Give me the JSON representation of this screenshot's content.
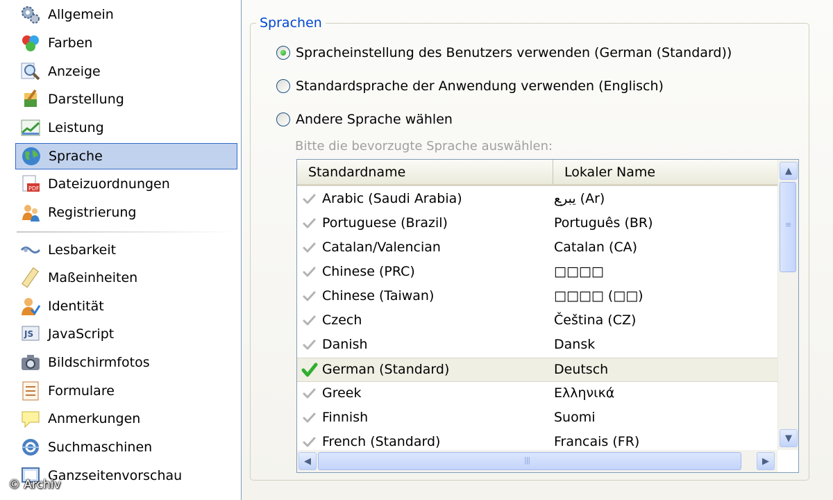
{
  "sidebar": {
    "items": [
      {
        "label": "Allgemein",
        "icon": "gears-icon"
      },
      {
        "label": "Farben",
        "icon": "color-balls-icon"
      },
      {
        "label": "Anzeige",
        "icon": "magnifier-icon"
      },
      {
        "label": "Darstellung",
        "icon": "paint-brush-icon"
      },
      {
        "label": "Leistung",
        "icon": "performance-chart-icon"
      },
      {
        "label": "Sprache",
        "icon": "globe-icon",
        "selected": true
      },
      {
        "label": "Dateizuordnungen",
        "icon": "file-association-icon"
      },
      {
        "label": "Registrierung",
        "icon": "users-icon"
      },
      {
        "label": "Lesbarkeit",
        "icon": "readability-icon"
      },
      {
        "label": "Maßeinheiten",
        "icon": "ruler-icon"
      },
      {
        "label": "Identität",
        "icon": "identity-icon"
      },
      {
        "label": "JavaScript",
        "icon": "javascript-icon"
      },
      {
        "label": "Bildschirmfotos",
        "icon": "camera-icon"
      },
      {
        "label": "Formulare",
        "icon": "form-icon"
      },
      {
        "label": "Anmerkungen",
        "icon": "notes-icon"
      },
      {
        "label": "Suchmaschinen",
        "icon": "search-engine-icon"
      },
      {
        "label": "Ganzseitenvorschau",
        "icon": "full-page-preview-icon"
      }
    ]
  },
  "group": {
    "title": "Sprachen",
    "options": [
      {
        "label": "Spracheinstellung des Benutzers verwenden (German (Standard))",
        "checked": true
      },
      {
        "label": "Standardsprache der Anwendung verwenden (Englisch)",
        "checked": false
      },
      {
        "label": "Andere Sprache wählen",
        "checked": false
      }
    ],
    "list_caption": "Bitte die bevorzugte Sprache auswählen:"
  },
  "list": {
    "columns": [
      "Standardname",
      "Lokaler Name"
    ],
    "rows": [
      {
        "std": "Arabic (Saudi Arabia)",
        "loc": "ي‍ب‍ر‍ع (Ar)",
        "selected": false
      },
      {
        "std": "Portuguese (Brazil)",
        "loc": "Português (BR)",
        "selected": false
      },
      {
        "std": "Catalan/Valencian",
        "loc": "Catalan (CA)",
        "selected": false
      },
      {
        "std": "Chinese (PRC)",
        "loc": "□□□□",
        "selected": false
      },
      {
        "std": "Chinese (Taiwan)",
        "loc": "□□□□ (□□)",
        "selected": false
      },
      {
        "std": "Czech",
        "loc": "Čeština (CZ)",
        "selected": false
      },
      {
        "std": "Danish",
        "loc": "Dansk",
        "selected": false
      },
      {
        "std": "German (Standard)",
        "loc": "Deutsch",
        "selected": true
      },
      {
        "std": "Greek",
        "loc": "Ελληνικά",
        "selected": false
      },
      {
        "std": "Finnish",
        "loc": "Suomi",
        "selected": false
      },
      {
        "std": "French (Standard)",
        "loc": "Francais (FR)",
        "selected": false
      }
    ]
  },
  "watermark": "© Archiv",
  "colors": {
    "accent": "#0046d5",
    "selection": "#c1d2ee",
    "selection_border": "#316ac5",
    "check_active": "#2fae2f",
    "check_inactive": "#a8a8a8"
  }
}
